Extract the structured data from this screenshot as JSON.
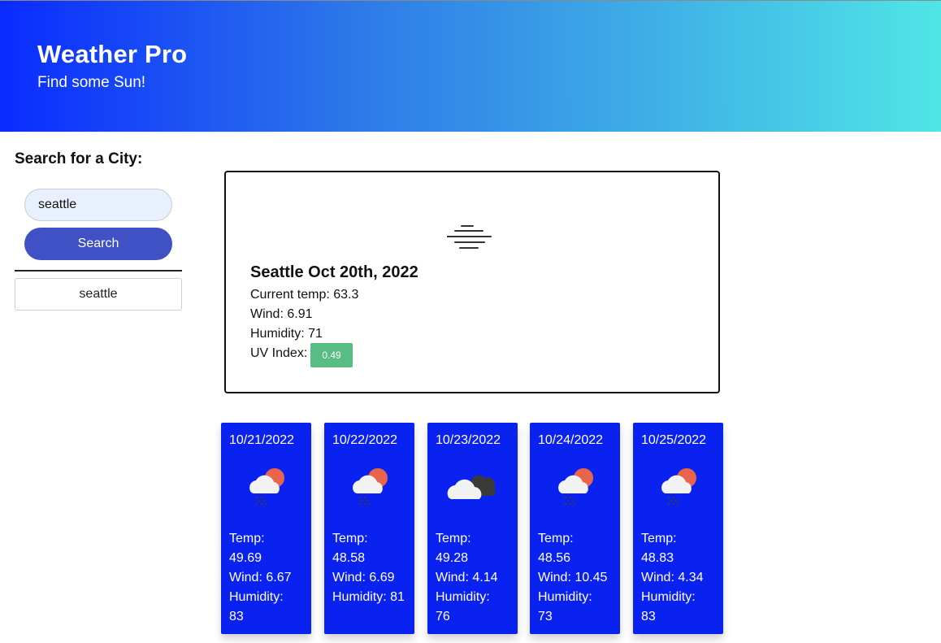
{
  "header": {
    "title": "Weather Pro",
    "subtitle": "Find some Sun!"
  },
  "sidebar": {
    "heading": "Search for a City:",
    "search_value": "seattle",
    "search_button": "Search",
    "history": [
      "seattle"
    ]
  },
  "current": {
    "icon": "mist-icon",
    "city_date": "Seattle Oct 20th, 2022",
    "temp": "Current temp: 63.3",
    "wind": "Wind: 6.91",
    "humidity": "Humidity: 71",
    "uv_label": "UV Index:",
    "uv_value": "0.49",
    "uv_color": "#58bd83"
  },
  "forecast": [
    {
      "date": "10/21/2022",
      "icon": "rain-sun-icon",
      "temp_label": "Temp:",
      "temp": "49.69",
      "wind": "Wind: 6.67",
      "humidity_label": "Humidity:",
      "humidity": "83"
    },
    {
      "date": "10/22/2022",
      "icon": "rain-sun-icon",
      "temp_label": "Temp:",
      "temp": "48.58",
      "wind": "Wind: 6.69",
      "humidity_label": "Humidity: 81",
      "humidity": ""
    },
    {
      "date": "10/23/2022",
      "icon": "cloudy-icon",
      "temp_label": "Temp:",
      "temp": "49.28",
      "wind": "Wind: 4.14",
      "humidity_label": "Humidity:",
      "humidity": "76"
    },
    {
      "date": "10/24/2022",
      "icon": "rain-sun-icon",
      "temp_label": "Temp:",
      "temp": "48.56",
      "wind": "Wind: 10.45",
      "humidity_label": "Humidity:",
      "humidity": "73"
    },
    {
      "date": "10/25/2022",
      "icon": "rain-sun-icon",
      "temp_label": "Temp:",
      "temp": "48.83",
      "wind": "Wind: 4.34",
      "humidity_label": "Humidity:",
      "humidity": "83"
    }
  ],
  "colors": {
    "header_start": "#0a2bff",
    "header_end": "#4fe6e6",
    "button": "#3f51c4",
    "forecast_card": "#0a22f0"
  }
}
